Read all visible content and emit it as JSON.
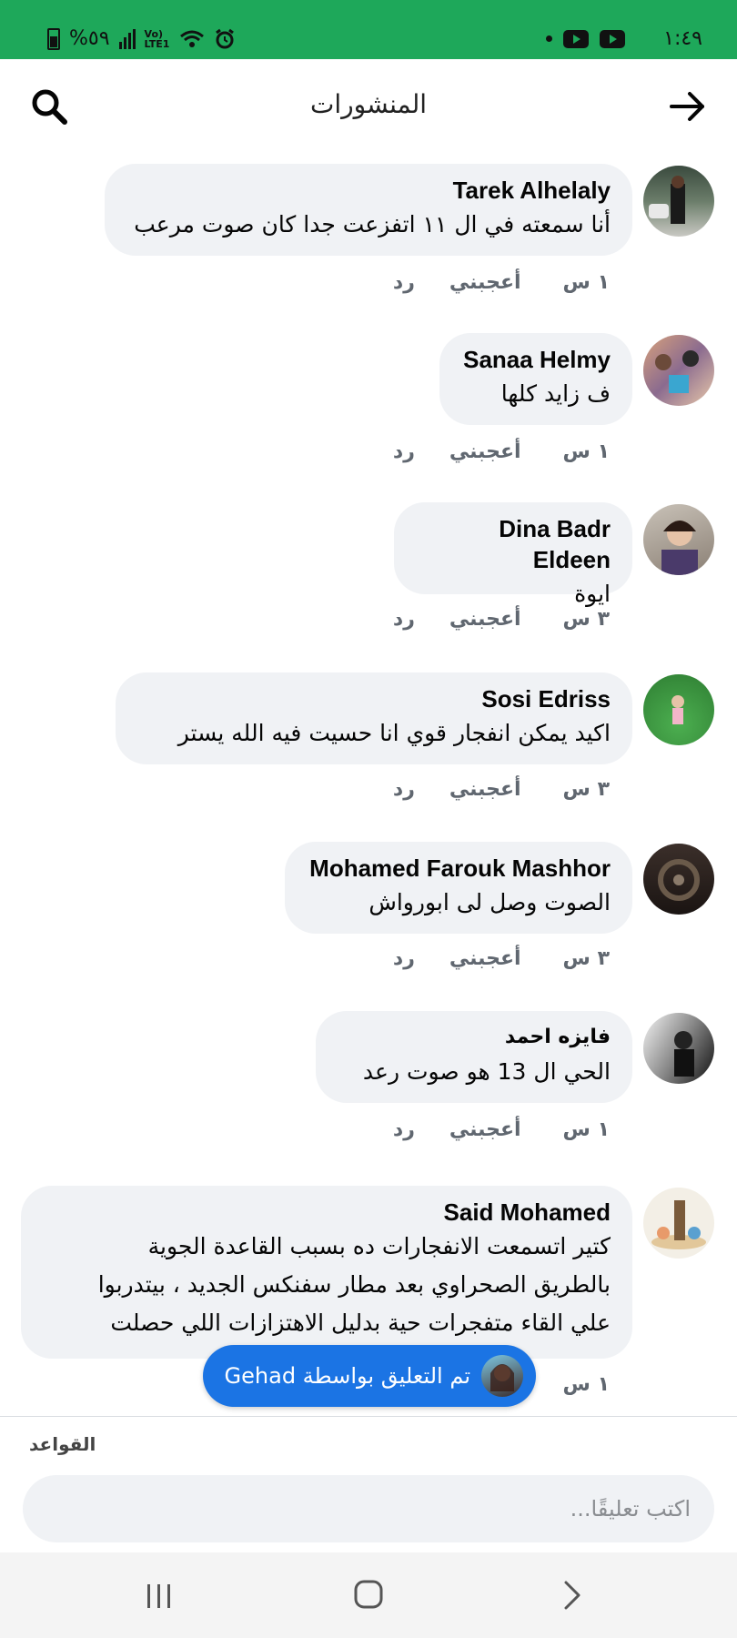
{
  "status_bar": {
    "battery": "%٥٩",
    "network": "Vo) LTE1",
    "time": "١:٤٩"
  },
  "header": {
    "title": "المنشورات",
    "search_icon": "search-icon",
    "back_icon": "arrow-right-icon"
  },
  "comments": [
    {
      "name": "Tarek Alhelaly",
      "lines": [
        "أنا سمعته في ال ١١ اتفزعت جدا كان صوت مرعب"
      ],
      "time": "١ س",
      "like": "أعجبني",
      "reply": "رد"
    },
    {
      "name": "Sanaa Helmy",
      "lines": [
        "ف زايد كلها"
      ],
      "time": "١ س",
      "like": "أعجبني",
      "reply": "رد"
    },
    {
      "name": "Dina Badr Eldeen",
      "lines": [
        "ايوة"
      ],
      "time": "٣ س",
      "like": "أعجبني",
      "reply": "رد"
    },
    {
      "name": "Sosi Edriss",
      "lines": [
        "اكيد يمكن انفجار قوي انا حسيت فيه الله يستر"
      ],
      "time": "٣ س",
      "like": "أعجبني",
      "reply": "رد"
    },
    {
      "name": "Mohamed Farouk Mashhor",
      "lines": [
        "الصوت وصل لى ابورواش"
      ],
      "time": "٣ س",
      "like": "أعجبني",
      "reply": "رد"
    },
    {
      "name": "فايزه احمد",
      "lines": [
        "الحي ال 13 هو صوت رعد"
      ],
      "time": "١ س",
      "like": "أعجبني",
      "reply": "رد"
    },
    {
      "name": "Said Mohamed",
      "lines": [
        "كتير اتسمعت الانفجارات ده بسبب القاعدة الجوية",
        "بالطريق الصحراوي بعد مطار سفنكس الجديد ، بيتدربوا",
        "علي القاء متفجرات حية بدليل الاهتزازات اللي حصلت"
      ],
      "time": "١ س"
    }
  ],
  "toast": {
    "text": "تم التعليق بواسطة Gehad"
  },
  "composer": {
    "rules_label": "القواعد",
    "placeholder": "اكتب تعليقًا..."
  },
  "nav": {
    "recents": "recents-icon",
    "home": "home-icon",
    "back": "back-chevron-icon"
  },
  "colors": {
    "status_bar": "#1ea85a",
    "bubble": "#f0f2f5",
    "toast": "#1b74e4"
  }
}
